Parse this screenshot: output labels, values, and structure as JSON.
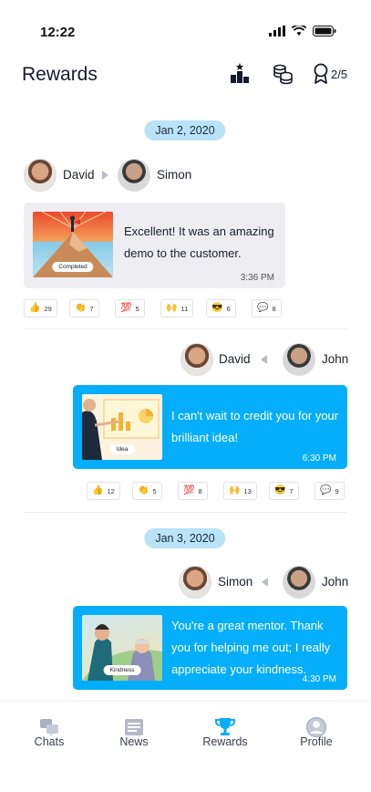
{
  "status": {
    "time": "12:22"
  },
  "header": {
    "title": "Rewards",
    "reward_count": "2/5",
    "icons": [
      "leaderboard-icon",
      "coins-icon",
      "award-ribbon-icon"
    ]
  },
  "feed": [
    {
      "date": "Jan 2, 2020",
      "from": "David",
      "to": "Simon",
      "direction": "incoming",
      "image_tag": "Completed",
      "message": "Excellent! It was an amazing demo to the customer.",
      "time": "3:36 PM",
      "reactions": [
        {
          "emoji": "👍",
          "count": "29"
        },
        {
          "emoji": "👏",
          "count": "7"
        },
        {
          "emoji": "💯",
          "count": "5"
        },
        {
          "emoji": "🙌",
          "count": "11"
        },
        {
          "emoji": "😎",
          "count": "6"
        },
        {
          "emoji": "💬",
          "count": "8"
        }
      ]
    },
    {
      "from": "David",
      "to": "John",
      "direction": "outgoing",
      "image_tag": "Idea",
      "message": "I can't wait to credit you for your brilliant idea!",
      "time": "6:30 PM",
      "reactions": [
        {
          "emoji": "👍",
          "count": "12"
        },
        {
          "emoji": "👏",
          "count": "5"
        },
        {
          "emoji": "💯",
          "count": "8"
        },
        {
          "emoji": "🙌",
          "count": "13"
        },
        {
          "emoji": "😎",
          "count": "7"
        },
        {
          "emoji": "💬",
          "count": "9"
        }
      ]
    },
    {
      "date": "Jan 3, 2020",
      "from": "Simon",
      "to": "John",
      "direction": "outgoing",
      "image_tag": "Kindness",
      "message": "You're a great mentor. Thank you for helping me out; I really appreciate your kindness.",
      "time": "4:30 PM"
    }
  ],
  "tabs": [
    {
      "label": "Chats",
      "icon": "chat-bubbles-icon",
      "active": false
    },
    {
      "label": "News",
      "icon": "newspaper-icon",
      "active": false
    },
    {
      "label": "Rewards",
      "icon": "trophy-icon",
      "active": true
    },
    {
      "label": "Profile",
      "icon": "user-circle-icon",
      "active": false
    }
  ],
  "colors": {
    "accent": "#04aefb",
    "pill": "#b9e4f8",
    "incoming_card": "#ededf2"
  }
}
